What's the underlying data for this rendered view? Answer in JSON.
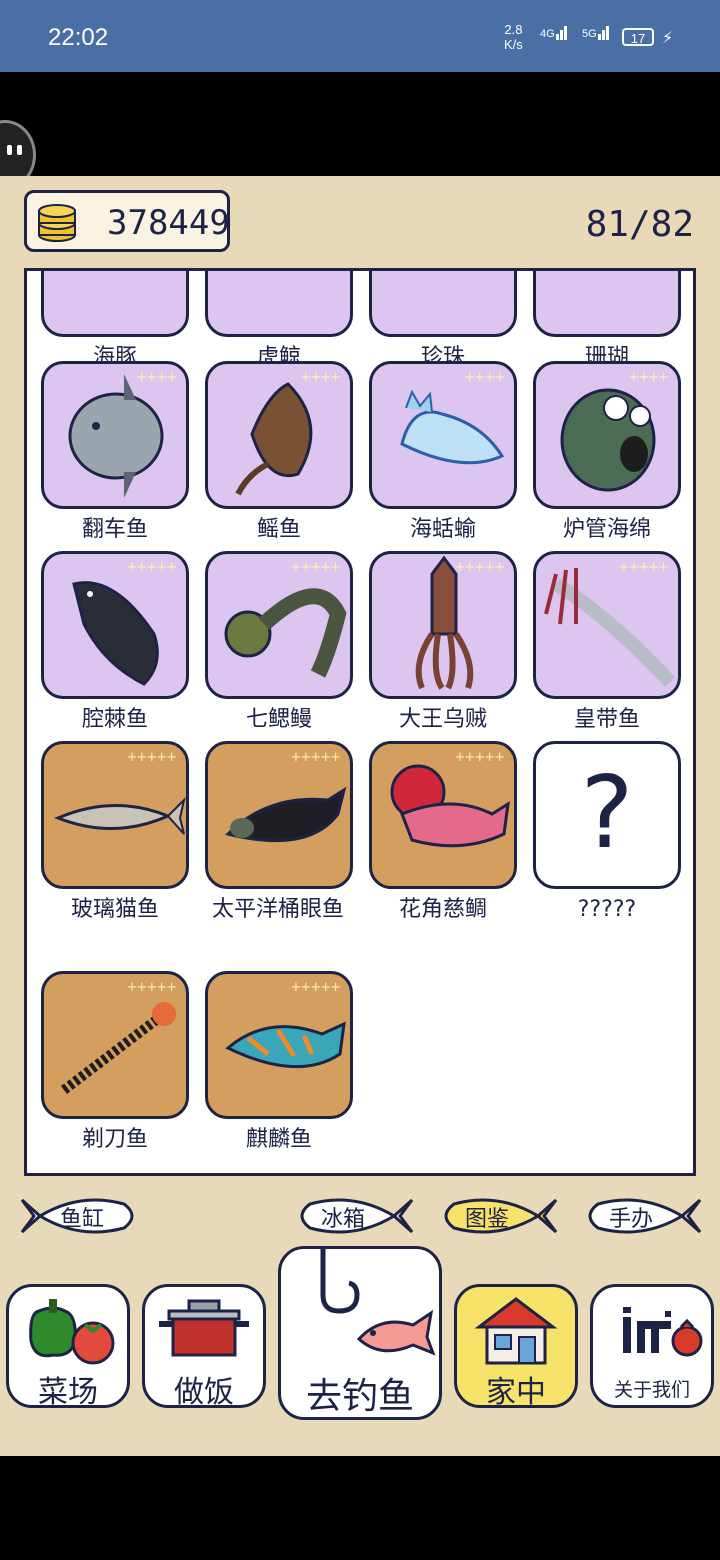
{
  "status_bar": {
    "time": "22:02",
    "net_speed_value": "2.8",
    "net_speed_unit": "K/s",
    "sig1": "4G",
    "sig2": "5G",
    "battery": "17"
  },
  "header": {
    "coins": "378449",
    "progress": "81/82"
  },
  "collection": [
    {
      "name": "海豚",
      "stars": "",
      "bg": "purple"
    },
    {
      "name": "虎鲸",
      "stars": "",
      "bg": "purple"
    },
    {
      "name": "珍珠",
      "stars": "",
      "bg": "purple"
    },
    {
      "name": "珊瑚",
      "stars": "",
      "bg": "purple"
    },
    {
      "name": "翻车鱼",
      "stars": "++++",
      "bg": "purple"
    },
    {
      "name": "鳐鱼",
      "stars": "++++",
      "bg": "purple"
    },
    {
      "name": "海蛞蝓",
      "stars": "++++",
      "bg": "purple"
    },
    {
      "name": "炉管海绵",
      "stars": "++++",
      "bg": "purple"
    },
    {
      "name": "腔棘鱼",
      "stars": "+++++",
      "bg": "purple"
    },
    {
      "name": "七鳃鳗",
      "stars": "+++++",
      "bg": "purple"
    },
    {
      "name": "大王乌贼",
      "stars": "+++++",
      "bg": "purple"
    },
    {
      "name": "皇带鱼",
      "stars": "+++++",
      "bg": "purple"
    },
    {
      "name": "玻璃猫鱼",
      "stars": "+++++",
      "bg": "gold"
    },
    {
      "name": "太平洋桶眼鱼",
      "stars": "+++++",
      "bg": "gold"
    },
    {
      "name": "花角慈鲷",
      "stars": "+++++",
      "bg": "gold"
    },
    {
      "name": "?????",
      "stars": "",
      "bg": "unknown",
      "symbol": "?"
    },
    {
      "name": "剃刀鱼",
      "stars": "+++++",
      "bg": "gold"
    },
    {
      "name": "麒麟鱼",
      "stars": "+++++",
      "bg": "gold"
    }
  ],
  "tabs": [
    {
      "label": "鱼缸",
      "active": false
    },
    {
      "label": "冰箱",
      "active": false
    },
    {
      "label": "图鉴",
      "active": true
    },
    {
      "label": "手办",
      "active": false
    }
  ],
  "nav": [
    {
      "label": "菜场",
      "active": false
    },
    {
      "label": "做饭",
      "active": false
    },
    {
      "label": "去钓鱼",
      "active": false
    },
    {
      "label": "家中",
      "active": true
    },
    {
      "label": "关于我们",
      "active": false
    }
  ],
  "colors": {
    "ink": "#1d2347",
    "panel_bg": "#e8dab9",
    "purple_tile": "#dcc5ee",
    "gold_tile": "#d39e5e",
    "active_yellow": "#f8e36a",
    "status_bar": "#4a6fa5"
  }
}
